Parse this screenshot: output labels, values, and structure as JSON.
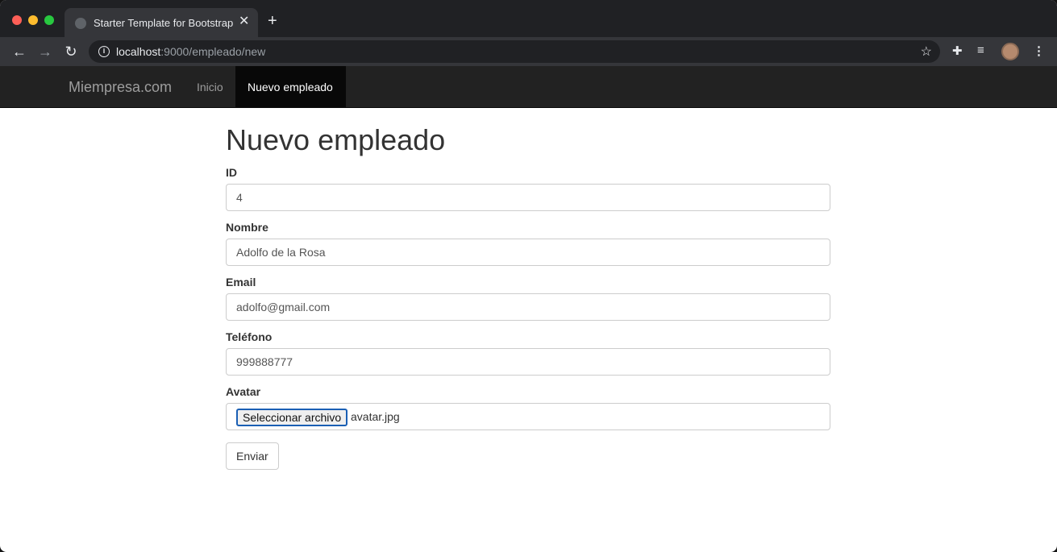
{
  "browser": {
    "tab_title": "Starter Template for Bootstrap",
    "tab_close": "✕",
    "new_tab": "+",
    "url_host": "localhost",
    "url_rest": ":9000/empleado/new"
  },
  "navbar": {
    "brand": "Miempresa.com",
    "links": [
      {
        "label": "Inicio"
      },
      {
        "label": "Nuevo empleado"
      }
    ]
  },
  "main": {
    "title": "Nuevo empleado",
    "fields": [
      {
        "label": "ID",
        "value": "4"
      },
      {
        "label": "Nombre",
        "value": "Adolfo de la Rosa"
      },
      {
        "label": "Email",
        "value": "adolfo@gmail.com"
      },
      {
        "label": "Teléfono",
        "value": "999888777"
      }
    ],
    "avatar": {
      "label": "Avatar",
      "button": "Seleccionar archivo",
      "file_name": "avatar.jpg"
    },
    "submit_label": "Enviar"
  }
}
